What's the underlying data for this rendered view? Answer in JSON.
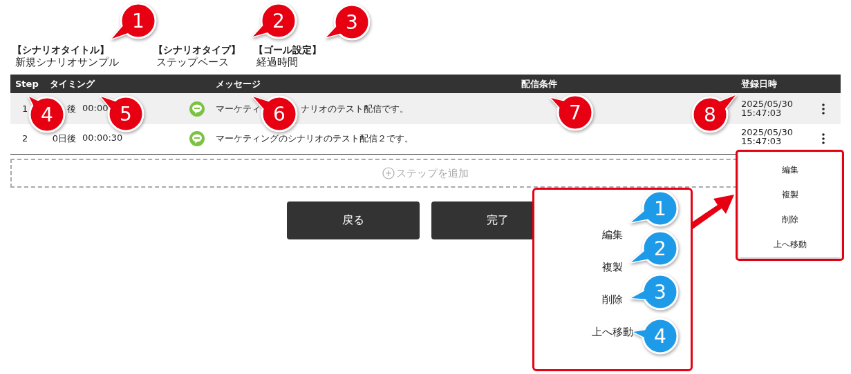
{
  "scenario": [
    {
      "label": "【シナリオタイトル】",
      "value": "新規シナリオサンプル"
    },
    {
      "label": "【シナリオタイプ】",
      "value": "ステップベース"
    },
    {
      "label": "【ゴール設定】",
      "value": "経過時間"
    }
  ],
  "table": {
    "columns": [
      "Step",
      "タイミング",
      "メッセージ",
      "配信条件",
      "登録日時"
    ],
    "rows": [
      {
        "step": "1",
        "days": "後",
        "time": "00:00",
        "message": [
          "マーケティ",
          "ナリオのテスト配信です。"
        ],
        "date": "2025/05/30",
        "clock": "15:47:03"
      },
      {
        "step": "2",
        "days": "0日後",
        "time": "00:00:30",
        "message": [
          "マーケティングのシナリオのテスト配信２です。"
        ],
        "date": "2025/05/30",
        "clock": "15:47:03"
      }
    ]
  },
  "add_step": "ステップを追加",
  "buttons": [
    "戻る",
    "完了"
  ],
  "row_menu": [
    "編集",
    "複製",
    "削除",
    "上へ移動"
  ],
  "zoomed_menu": [
    "編集",
    "複製",
    "削除",
    "上へ移動"
  ],
  "callouts": [
    "1",
    "2",
    "3",
    "4",
    "5",
    "6",
    "7",
    "8"
  ],
  "menu_callouts": [
    "1",
    "2",
    "3",
    "4"
  ]
}
